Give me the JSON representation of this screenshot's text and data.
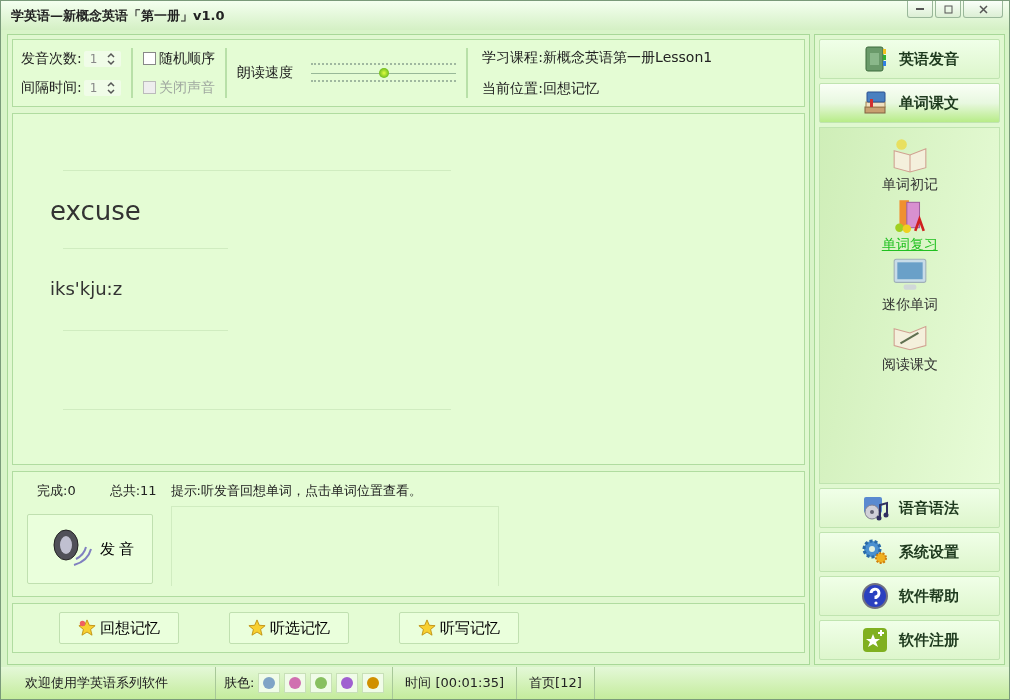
{
  "window": {
    "title": "学英语—新概念英语「第一册」v1.0"
  },
  "settings": {
    "repeat": {
      "label": "发音次数:",
      "value": "1"
    },
    "interval": {
      "label": "间隔时间:",
      "value": "1"
    },
    "options": [
      {
        "label": "随机顺序",
        "checked": false,
        "disabled": false
      },
      {
        "label": "关闭声音",
        "checked": false,
        "disabled": true
      }
    ],
    "speed": {
      "label": "朗读速度",
      "level": 0.5
    },
    "course": {
      "label": "学习课程:",
      "value": "新概念英语第一册Lesson1"
    },
    "position": {
      "label": "当前位置:",
      "value": "回想记忆"
    }
  },
  "card": {
    "word": "excuse",
    "phonetic": "iks'kju:z"
  },
  "progress": {
    "done": "完成:0",
    "total": "总共:11",
    "hint": "提示:听发音回想单词，点击单词位置查看。",
    "speak_button": "发 音"
  },
  "modes": [
    {
      "label": "回想记忆",
      "kind": "recall"
    },
    {
      "label": "听选记忆",
      "kind": "choose"
    },
    {
      "label": "听写记忆",
      "kind": "dictate"
    }
  ],
  "sidebar": {
    "top": [
      {
        "label": "英语发音",
        "kind": "notebook",
        "selected": false
      },
      {
        "label": "单词课文",
        "kind": "books",
        "selected": true
      }
    ],
    "sub_items": [
      {
        "label": "单词初记",
        "kind": "open-book",
        "selected": false
      },
      {
        "label": "单词复习",
        "kind": "abc-books",
        "selected": true
      },
      {
        "label": "迷你单词",
        "kind": "monitor",
        "selected": false
      },
      {
        "label": "阅读课文",
        "kind": "pen-book",
        "selected": false
      }
    ],
    "bottom": [
      {
        "label": "语音语法",
        "kind": "music",
        "selected": false
      },
      {
        "label": "系统设置",
        "kind": "gears",
        "selected": false
      },
      {
        "label": "软件帮助",
        "kind": "help",
        "selected": false
      },
      {
        "label": "软件注册",
        "kind": "star",
        "selected": false
      }
    ]
  },
  "status_bar": {
    "welcome": "欢迎使用学英语系列软件",
    "skin_label": "肤色:",
    "skins": [
      {
        "color": "#7fa3c6"
      },
      {
        "color": "#d070b0"
      },
      {
        "color": "#88c060"
      },
      {
        "color": "#a060d0"
      },
      {
        "color": "#d09000"
      }
    ],
    "time": "时间 [00:01:35]",
    "page": "首页[12]"
  }
}
